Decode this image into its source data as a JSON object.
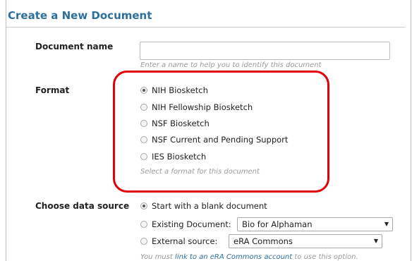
{
  "page": {
    "title": "Create a New Document"
  },
  "document_name": {
    "label": "Document name",
    "value": "",
    "hint": "Enter a name to help you to identify this document"
  },
  "format": {
    "label": "Format",
    "options": [
      {
        "label": "NIH Biosketch",
        "checked": true
      },
      {
        "label": "NIH Fellowship Biosketch",
        "checked": false
      },
      {
        "label": "NSF Biosketch",
        "checked": false
      },
      {
        "label": "NSF Current and Pending Support",
        "checked": false
      },
      {
        "label": "IES Biosketch",
        "checked": false
      }
    ],
    "hint": "Select a format for this document"
  },
  "data_source": {
    "label": "Choose data source",
    "blank_label": "Start with a blank document",
    "existing_label": "Existing Document:",
    "existing_selected": "Bio for Alphaman",
    "external_label": "External source:",
    "external_selected": "eRA Commons",
    "note_prefix": "You must ",
    "note_link": "link to an eRA Commons account",
    "note_suffix": " to use this option."
  },
  "colors": {
    "title": "#2e6f9d",
    "highlight": "#e0000a",
    "hint": "#9a9a9a"
  },
  "icons": {
    "dropdown": "chevron-down-icon",
    "radio": "radio-button"
  }
}
